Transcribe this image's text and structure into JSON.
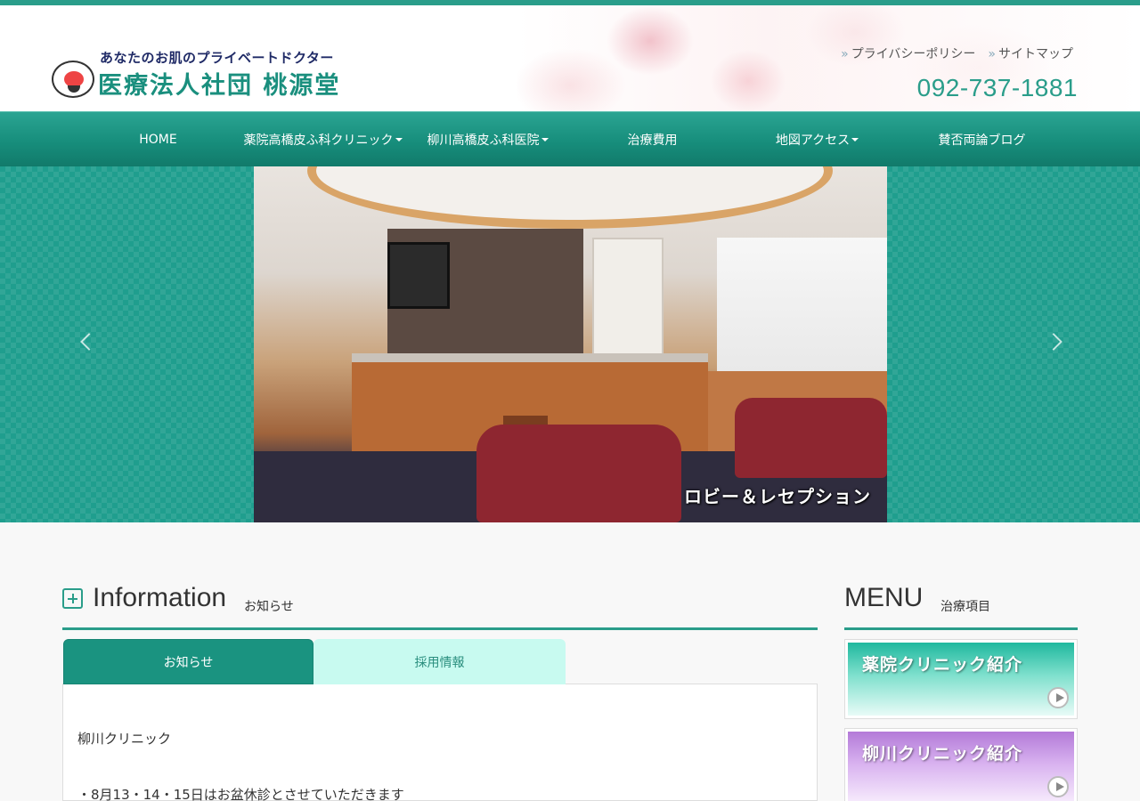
{
  "header": {
    "tagline": "あなたのお肌のプライベートドクター",
    "org_name": "医療法人社団 桃源堂",
    "util_links": [
      {
        "label": "プライバシーポリシー"
      },
      {
        "label": "サイトマップ"
      }
    ],
    "link_marker": "»",
    "phone": "092-737-1881"
  },
  "nav": {
    "items": [
      {
        "label": "HOME",
        "dropdown": false
      },
      {
        "label": "薬院高橋皮ふ科クリニック",
        "dropdown": true
      },
      {
        "label": "柳川高橋皮ふ科医院",
        "dropdown": true
      },
      {
        "label": "治療費用",
        "dropdown": false
      },
      {
        "label": "地図アクセス",
        "dropdown": true
      },
      {
        "label": "賛否両論ブログ",
        "dropdown": false
      }
    ]
  },
  "hero": {
    "caption": "ロビー＆レセプション"
  },
  "info": {
    "title": "Information",
    "subtitle": "お知らせ",
    "tabs": [
      {
        "label": "お知らせ",
        "active": true
      },
      {
        "label": "採用情報",
        "active": false
      }
    ],
    "lines": [
      "柳川クリニック",
      "・8月13・14・15日はお盆休診とさせていただきます"
    ]
  },
  "menu": {
    "title": "MENU",
    "subtitle": "治療項目",
    "banners": [
      {
        "label": "薬院クリニック紹介"
      },
      {
        "label": "柳川クリニック紹介"
      }
    ]
  },
  "colors": {
    "accent": "#2a9d8a",
    "nav": "#178e7c",
    "tab_active": "#1a9380",
    "tab_inactive": "#c8faf0"
  }
}
